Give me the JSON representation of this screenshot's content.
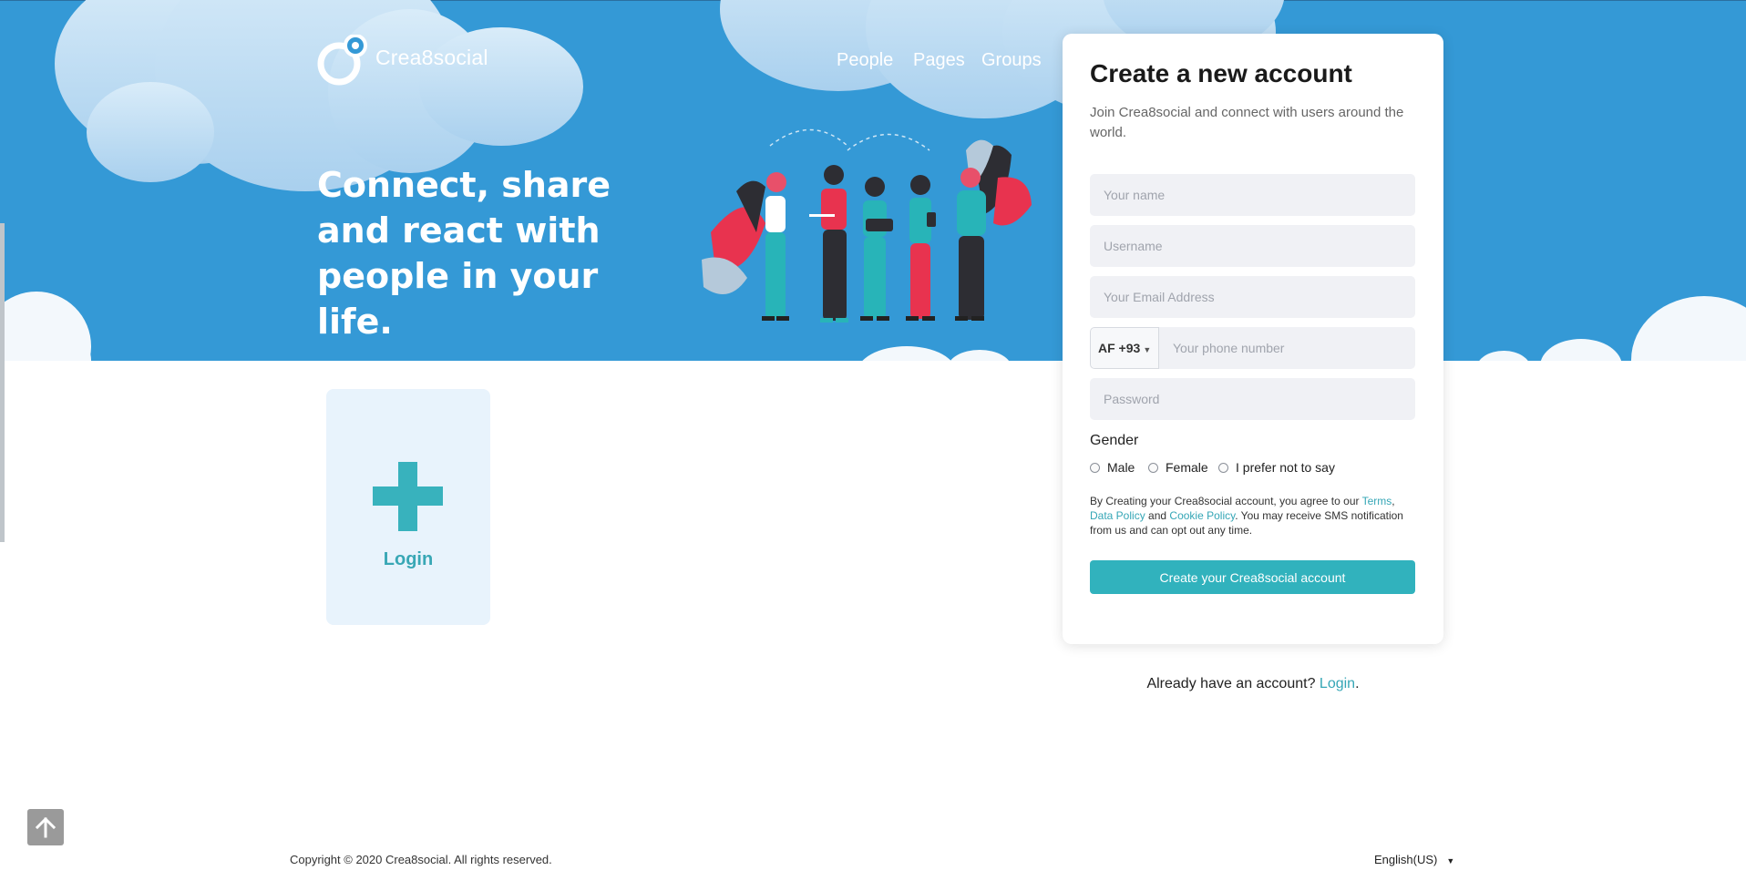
{
  "brand": {
    "name": "Crea8social"
  },
  "nav": {
    "items": [
      "People",
      "Pages",
      "Groups"
    ]
  },
  "hero": {
    "tagline": "Connect, share and react with people in your life."
  },
  "login_tile": {
    "label": "Login"
  },
  "signup": {
    "title": "Create a new account",
    "subtitle": "Join Crea8social and connect with users around the world.",
    "name_placeholder": "Your name",
    "username_placeholder": "Username",
    "email_placeholder": "Your Email Address",
    "country_code": "AF +93",
    "phone_placeholder": "Your phone number",
    "password_placeholder": "Password",
    "gender_label": "Gender",
    "gender_options": [
      "Male",
      "Female",
      "I prefer not to say"
    ],
    "terms": {
      "prefix": "By Creating your Crea8social account, you agree to our ",
      "terms_link": "Terms",
      "sep1": ", ",
      "data_policy_link": "Data Policy",
      "sep2": " and ",
      "cookie_policy_link": "Cookie Policy",
      "suffix": ". You may receive SMS notification from us and can opt out any time."
    },
    "submit_label": "Create your Crea8social account"
  },
  "already": {
    "text": "Already have an account? ",
    "link": "Login",
    "end": "."
  },
  "footer": {
    "copyright": "Copyright © 2020 Crea8social. All rights reserved.",
    "language": "English(US)"
  },
  "colors": {
    "hero_bg": "#3499d6",
    "accent": "#31b2bd",
    "login_tile_bg": "#e8f3fc"
  },
  "icons": {
    "scroll_top": "arrow-up-icon",
    "plus": "plus-icon",
    "logo": "logo-mark-icon"
  }
}
